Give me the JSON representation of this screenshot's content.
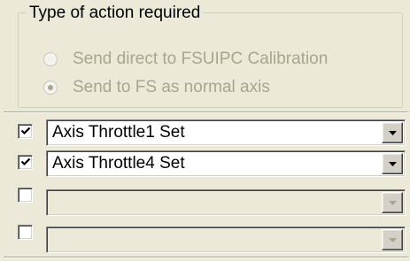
{
  "action_group": {
    "legend": "Type of action required",
    "options": [
      {
        "label": "Send direct to FSUIPC Calibration",
        "selected": false,
        "enabled": false
      },
      {
        "label": "Send to FS as normal axis",
        "selected": true,
        "enabled": false
      }
    ]
  },
  "axis_rows": [
    {
      "checked": true,
      "value": "Axis Throttle1 Set",
      "enabled": true
    },
    {
      "checked": true,
      "value": "Axis Throttle4 Set",
      "enabled": true
    },
    {
      "checked": false,
      "value": "",
      "enabled": false
    },
    {
      "checked": false,
      "value": "",
      "enabled": false
    }
  ],
  "icons": {
    "checkmark": "checkmark-icon",
    "dropdown": "chevron-down-icon",
    "radio_dot": "radio-dot-icon"
  },
  "colors": {
    "face": "#ece9d8",
    "disabled_text": "#a7a690",
    "arrow_enabled": "#000000",
    "arrow_disabled": "#a7a690"
  }
}
